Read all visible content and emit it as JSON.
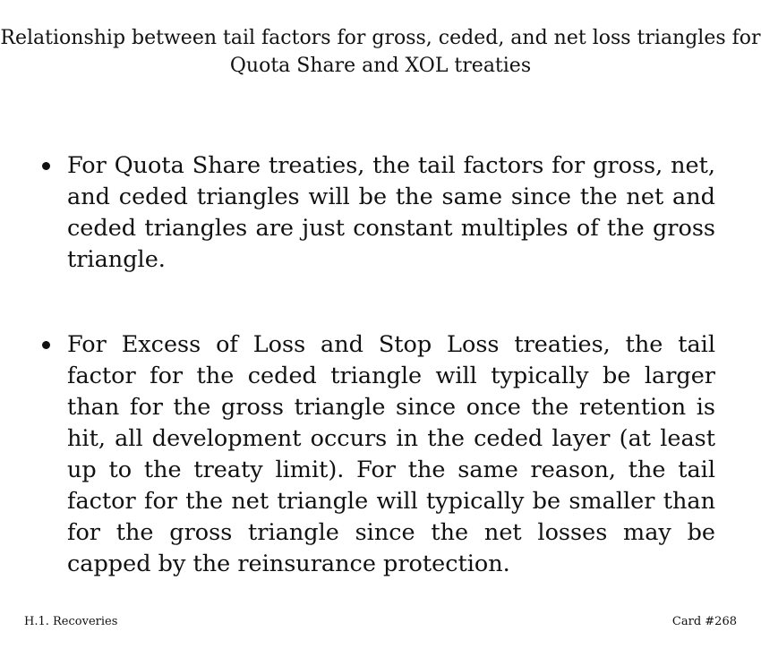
{
  "card": {
    "title": "Relationship between tail factors for gross, ceded, and net loss triangles for Quota Share and XOL treaties",
    "bullets": [
      {
        "text": "For Quota Share treaties, the tail factors for gross, net, and ceded triangles will be the same since the net and ceded triangles are just constant multiples of the gross triangle."
      },
      {
        "text": "For Excess of Loss and Stop Loss treaties, the tail factor for the ceded triangle will typically be larger than for the gross triangle since once the retention is hit, all development occurs in the ceded layer (at least up to the treaty limit). For the same reason, the tail factor for the net triangle will typically be smaller than for the gross triangle since the net losses may be capped by the reinsurance protection."
      }
    ],
    "footer": {
      "section": "H.1. Recoveries",
      "card_number": "Card #268"
    }
  }
}
